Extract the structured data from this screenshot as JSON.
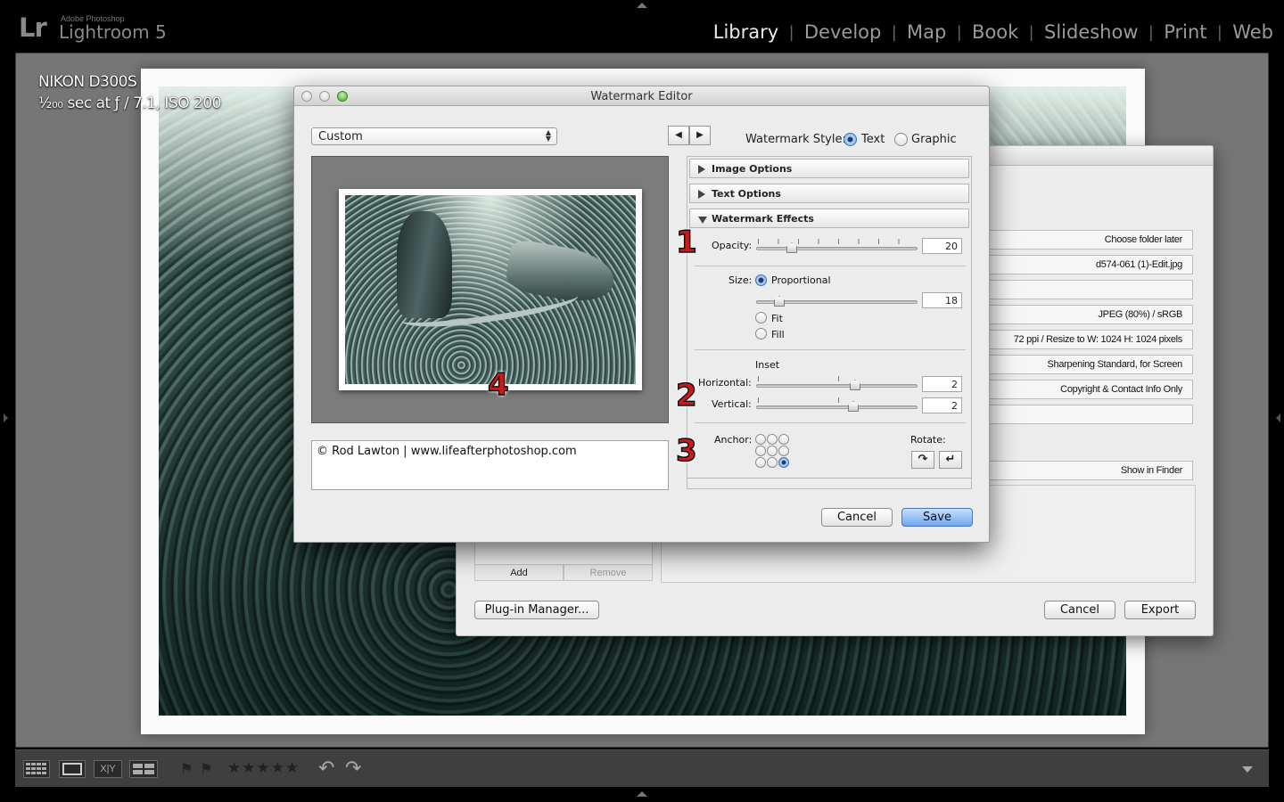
{
  "app": {
    "brand_short": "Lr",
    "brand_sub": "Adobe Photoshop",
    "brand_name": "Lightroom 5",
    "modules": [
      {
        "label": "Library",
        "active": true
      },
      {
        "label": "Develop",
        "active": false
      },
      {
        "label": "Map",
        "active": false
      },
      {
        "label": "Book",
        "active": false
      },
      {
        "label": "Slideshow",
        "active": false
      },
      {
        "label": "Print",
        "active": false
      },
      {
        "label": "Web",
        "active": false
      }
    ]
  },
  "photo_info": {
    "camera": "NIKON D300S",
    "exposure": "¹⁄₂₀₀ sec at ƒ / 7.1, ISO 200"
  },
  "filmstrip": {
    "stars": "★★★★★",
    "compare_label": "X|Y",
    "rotate_left": "↶",
    "rotate_right": "↷"
  },
  "export_dialog": {
    "rows": [
      "Choose folder later",
      "d574-061 (1)-Edit.jpg",
      "",
      "JPEG (80%) / sRGB",
      "72 ppi / Resize to W: 1024 H: 1024 pixels",
      "Sharpening Standard, for Screen",
      "Copyright & Contact Info Only",
      "",
      "Show in Finder"
    ],
    "add_label": "Add",
    "remove_label": "Remove",
    "plugin_manager_label": "Plug-in Manager...",
    "cancel_label": "Cancel",
    "export_label": "Export"
  },
  "watermark_editor": {
    "title": "Watermark Editor",
    "preset": "Custom",
    "prev_arrow": "◀",
    "next_arrow": "▶",
    "style_label": "Watermark Style:",
    "style_text": "Text",
    "style_graphic": "Graphic",
    "style_selected": "Text",
    "watermark_text": "© Rod Lawton | www.lifeafterphotoshop.com",
    "sections": {
      "image_options": "Image Options",
      "text_options": "Text Options",
      "watermark_effects": "Watermark Effects"
    },
    "opacity_label": "Opacity:",
    "opacity_value": "20",
    "size_label": "Size:",
    "size_proportional": "Proportional",
    "size_fit": "Fit",
    "size_fill": "Fill",
    "size_selected": "Proportional",
    "size_value": "18",
    "inset_label": "Inset",
    "horizontal_label": "Horizontal:",
    "horizontal_value": "2",
    "vertical_label": "Vertical:",
    "vertical_value": "2",
    "anchor_label": "Anchor:",
    "anchor_selected": "bottom-right",
    "rotate_label": "Rotate:",
    "rotate_cw": "↷",
    "rotate_ccw": "↵",
    "cancel_label": "Cancel",
    "save_label": "Save"
  },
  "callouts": [
    "1",
    "2",
    "3",
    "4"
  ],
  "colors": {
    "accent": "#6fa8ee",
    "callout": "#d01818",
    "chrome": "#000000"
  }
}
